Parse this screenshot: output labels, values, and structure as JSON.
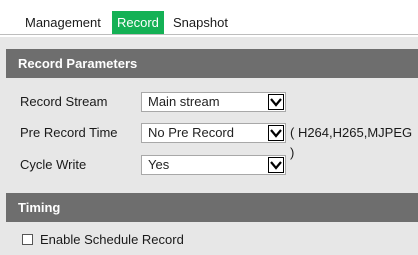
{
  "tabs": [
    {
      "label": "Management",
      "active": false
    },
    {
      "label": "Record",
      "active": true
    },
    {
      "label": "Snapshot",
      "active": false
    }
  ],
  "colors": {
    "active_tab": "#14b155",
    "section_header": "#6e6e6e",
    "page_bg": "#e7e7e7"
  },
  "record_parameters": {
    "title": "Record Parameters",
    "record_stream": {
      "label": "Record Stream",
      "value": "Main stream"
    },
    "pre_record_time": {
      "label": "Pre Record Time",
      "value": "No Pre Record",
      "note": "( H264,H265,MJPEG )"
    },
    "cycle_write": {
      "label": "Cycle Write",
      "value": "Yes"
    }
  },
  "timing": {
    "title": "Timing",
    "enable_schedule": {
      "label": "Enable Schedule Record",
      "checked": false
    }
  }
}
